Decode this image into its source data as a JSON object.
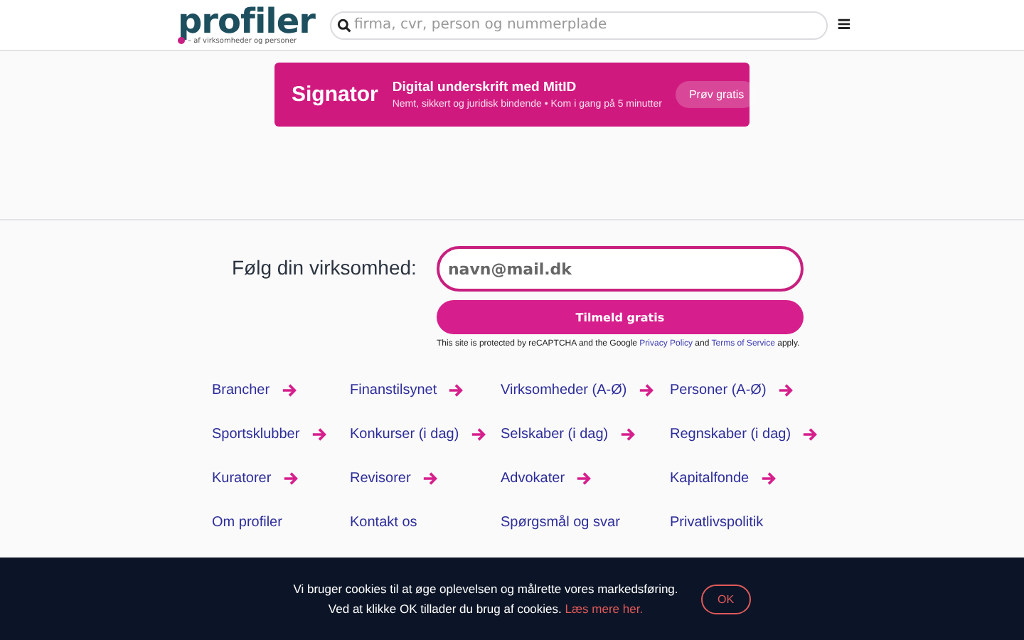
{
  "header": {
    "logo": "profiler",
    "tagline": "– af virksomheder og personer",
    "search": {
      "placeholder": "firma, cvr, person og nummerplade"
    },
    "menu_icon": "≡"
  },
  "banner": {
    "brand": "Signator",
    "title": "Digital underskrift med MitID",
    "subtitle": "Nemt, sikkert og juridisk bindende • Kom i gang på 5 minutter",
    "button": "Prøv gratis"
  },
  "signup": {
    "label": "Følg din virksomhed:",
    "email": {
      "placeholder": "navn@mail.dk"
    },
    "button": "Tilmeld gratis",
    "notice_before": "This site is protected by reCAPTCHA and the Google ",
    "privacy_link": "Privacy Policy",
    "notice_and": " and ",
    "terms_link": "Terms of Service",
    "notice_after": " apply."
  },
  "links": [
    {
      "label": "Brancher",
      "arrow": true
    },
    {
      "label": "Finanstilsynet",
      "arrow": true
    },
    {
      "label": "Virksomheder (A-Ø)",
      "arrow": true
    },
    {
      "label": "Personer (A-Ø)",
      "arrow": true
    },
    {
      "label": "Sportsklubber",
      "arrow": true
    },
    {
      "label": "Konkurser (i dag)",
      "arrow": true
    },
    {
      "label": "Selskaber (i dag)",
      "arrow": true
    },
    {
      "label": "Regnskaber (i dag)",
      "arrow": true
    },
    {
      "label": "Kuratorer",
      "arrow": true
    },
    {
      "label": "Revisorer",
      "arrow": true
    },
    {
      "label": "Advokater",
      "arrow": true
    },
    {
      "label": "Kapitalfonde",
      "arrow": true
    },
    {
      "label": "Om profiler",
      "arrow": false
    },
    {
      "label": "Kontakt os",
      "arrow": false
    },
    {
      "label": "Spørgsmål og svar",
      "arrow": false
    },
    {
      "label": "Privatlivspolitik",
      "arrow": false
    }
  ],
  "cookie_bar": {
    "line1": "Vi bruger cookies til at øge oplevelsen og målrette vores markedsføring.",
    "line2": "Ved at klikke OK tillader du brug af cookies.",
    "link": "Læs mere her.",
    "button": "OK"
  }
}
